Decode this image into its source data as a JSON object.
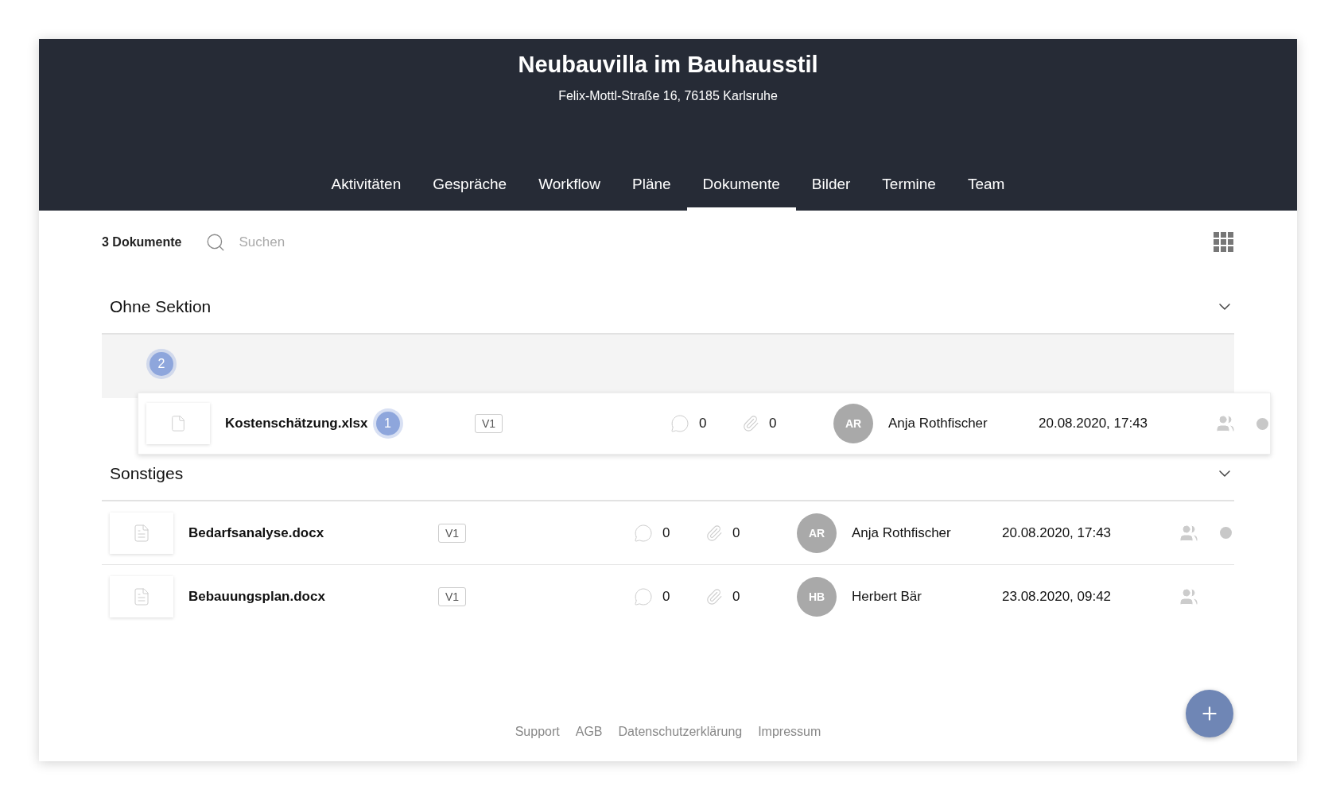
{
  "header": {
    "title": "Neubauvilla im Bauhausstil",
    "address": "Felix-Mottl-Straße 16, 76185 Karlsruhe"
  },
  "tabs": [
    {
      "label": "Aktivitäten",
      "selected": false
    },
    {
      "label": "Gespräche",
      "selected": false
    },
    {
      "label": "Workflow",
      "selected": false
    },
    {
      "label": "Pläne",
      "selected": false
    },
    {
      "label": "Dokumente",
      "selected": true
    },
    {
      "label": "Bilder",
      "selected": false
    },
    {
      "label": "Termine",
      "selected": false
    },
    {
      "label": "Team",
      "selected": false
    }
  ],
  "toolbar": {
    "count": "3 Dokumente",
    "search_placeholder": "Suchen"
  },
  "sections": [
    {
      "title": "Ohne Sektion",
      "expanded": true,
      "drop_zone": {
        "badge": "2"
      },
      "dragged": {
        "kind": "file",
        "name": "Kostenschätzung.xlsx",
        "badge": "1",
        "version": "V1",
        "comments": "0",
        "attachments": "0",
        "initials": "AR",
        "author": "Anja Rothfischer",
        "date": "20.08.2020, 17:43",
        "status_dot": true
      }
    },
    {
      "title": "Sonstiges",
      "expanded": true,
      "documents": [
        {
          "kind": "word",
          "name": "Bedarfsanalyse.docx",
          "version": "V1",
          "comments": "0",
          "attachments": "0",
          "initials": "AR",
          "author": "Anja Rothfischer",
          "date": "20.08.2020, 17:43",
          "status_dot": true
        },
        {
          "kind": "word",
          "name": "Bebauungsplan.docx",
          "version": "V1",
          "comments": "0",
          "attachments": "0",
          "initials": "HB",
          "author": "Herbert Bär",
          "date": "23.08.2020, 09:42",
          "status_dot": false
        }
      ]
    }
  ],
  "footer": {
    "links": [
      "Support",
      "AGB",
      "Datenschutzerklärung",
      "Impressum"
    ]
  }
}
